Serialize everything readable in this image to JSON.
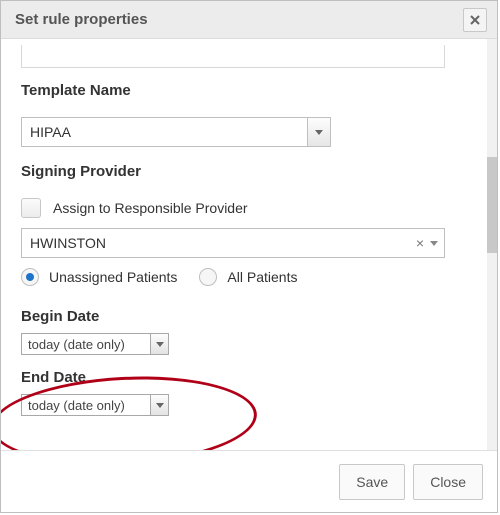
{
  "dialog": {
    "title": "Set rule properties"
  },
  "labels": {
    "template_name": "Template Name",
    "signing_provider": "Signing Provider",
    "assign_responsible": "Assign to Responsible Provider",
    "begin_date": "Begin Date",
    "end_date": "End Date"
  },
  "template": {
    "value": "HIPAA"
  },
  "provider": {
    "value": "HWINSTON"
  },
  "radio": {
    "unassigned": {
      "label": "Unassigned Patients",
      "selected": true
    },
    "all": {
      "label": "All Patients",
      "selected": false
    }
  },
  "begin_date": {
    "value": "today (date only)"
  },
  "end_date": {
    "value": "today (date only)"
  },
  "buttons": {
    "save": "Save",
    "close": "Close"
  }
}
